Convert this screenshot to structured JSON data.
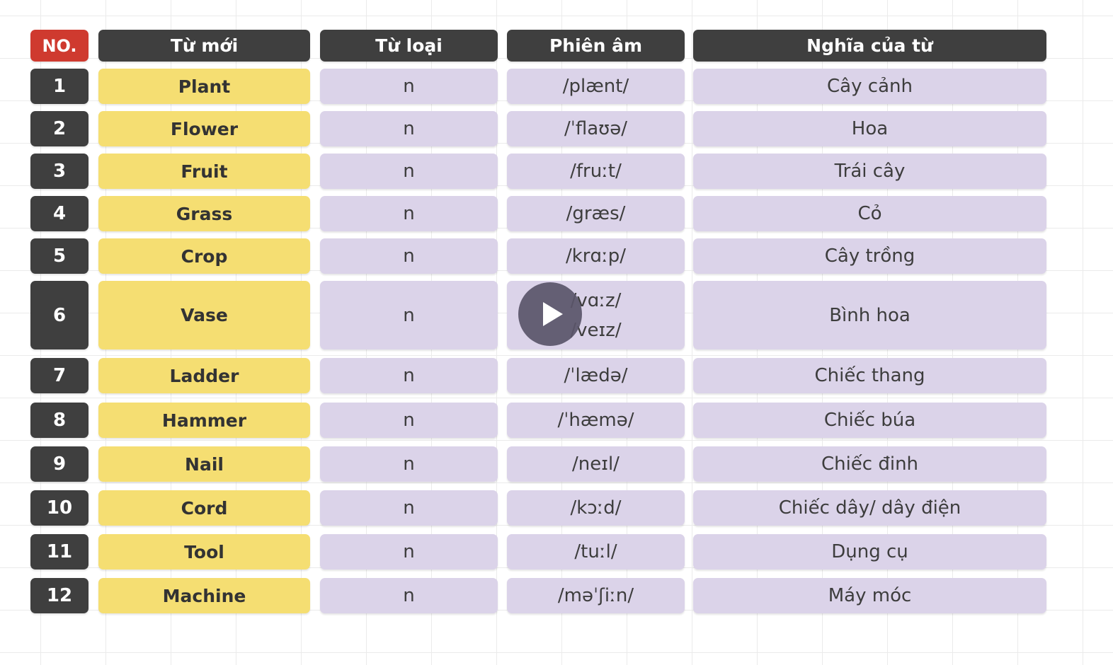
{
  "header": {
    "no": "NO.",
    "word": "Từ mới",
    "pos": "Từ loại",
    "ipa": "Phiên âm",
    "meaning": "Nghĩa của từ"
  },
  "rows": [
    {
      "no": "1",
      "word": "Plant",
      "pos": "n",
      "ipa": [
        "/plænt/"
      ],
      "meaning": "Cây cảnh"
    },
    {
      "no": "2",
      "word": "Flower",
      "pos": "n",
      "ipa": [
        "/ˈflaʊə/"
      ],
      "meaning": "Hoa"
    },
    {
      "no": "3",
      "word": "Fruit",
      "pos": "n",
      "ipa": [
        "/fruːt/"
      ],
      "meaning": "Trái cây"
    },
    {
      "no": "4",
      "word": "Grass",
      "pos": "n",
      "ipa": [
        "/græs/"
      ],
      "meaning": "Cỏ"
    },
    {
      "no": "5",
      "word": "Crop",
      "pos": "n",
      "ipa": [
        "/krɑːp/"
      ],
      "meaning": "Cây trồng"
    },
    {
      "no": "6",
      "word": "Vase",
      "pos": "n",
      "ipa": [
        "/vɑːz/",
        "/veɪz/"
      ],
      "meaning": "Bình hoa"
    },
    {
      "no": "7",
      "word": "Ladder",
      "pos": "n",
      "ipa": [
        "/ˈlædə/"
      ],
      "meaning": "Chiếc thang"
    },
    {
      "no": "8",
      "word": "Hammer",
      "pos": "n",
      "ipa": [
        "/ˈhæmə/"
      ],
      "meaning": "Chiếc búa"
    },
    {
      "no": "9",
      "word": "Nail",
      "pos": "n",
      "ipa": [
        "/neɪl/"
      ],
      "meaning": "Chiếc đinh"
    },
    {
      "no": "10",
      "word": "Cord",
      "pos": "n",
      "ipa": [
        "/kɔːd/"
      ],
      "meaning": "Chiếc dây/ dây điện"
    },
    {
      "no": "11",
      "word": "Tool",
      "pos": "n",
      "ipa": [
        "/tuːl/"
      ],
      "meaning": "Dụng cụ"
    },
    {
      "no": "12",
      "word": "Machine",
      "pos": "n",
      "ipa": [
        "/məˈʃiːn/"
      ],
      "meaning": "Máy móc"
    }
  ],
  "colors": {
    "header_no": "#cf3a2f",
    "header": "#3f3f3f",
    "word_cell": "#f5de72",
    "value_cell": "#dbd3e9"
  },
  "play_button": {
    "icon": "play-icon"
  }
}
